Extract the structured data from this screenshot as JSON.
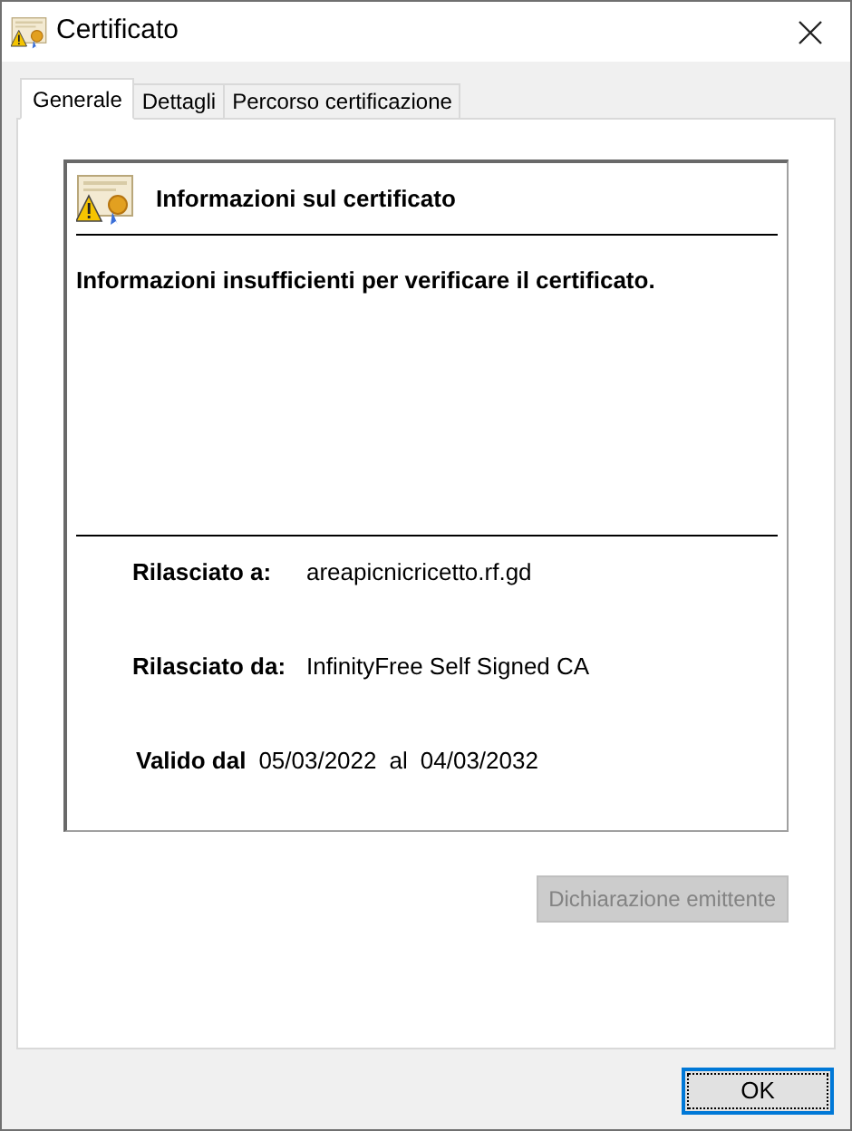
{
  "window": {
    "title": "Certificato"
  },
  "tabs": [
    {
      "label": "Generale",
      "selected": true
    },
    {
      "label": "Dettagli",
      "selected": false
    },
    {
      "label": "Percorso certificazione",
      "selected": false
    }
  ],
  "info": {
    "heading": "Informazioni sul certificato",
    "message": "Informazioni insufficienti per verificare il certificato.",
    "issued_to": {
      "label": "Rilasciato a:",
      "value": "areapicnicricetto.rf.gd"
    },
    "issued_by": {
      "label": "Rilasciato da:",
      "value": "InfinityFree Self Signed CA"
    },
    "validity": {
      "label": "Valido dal",
      "from": "05/03/2022",
      "separator": "al",
      "to": "04/03/2032"
    }
  },
  "issuer_statement_button": {
    "label": "Dichiarazione emittente",
    "disabled": true
  },
  "ok_button": {
    "label": "OK",
    "default": true
  }
}
